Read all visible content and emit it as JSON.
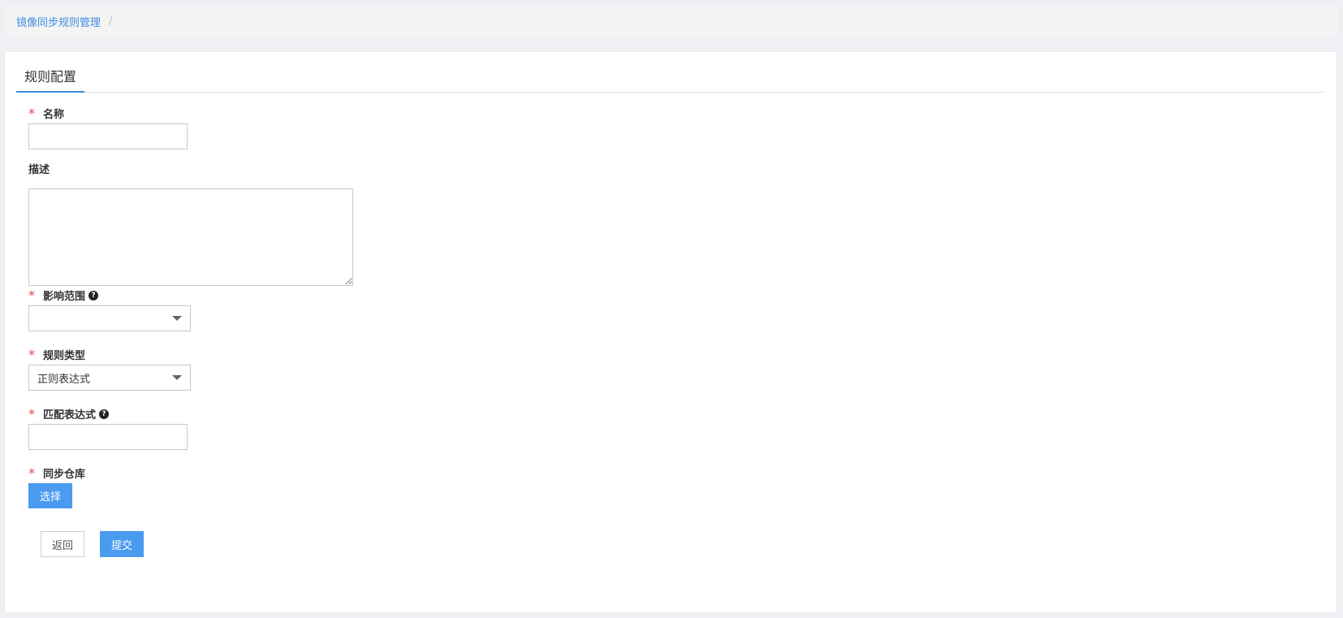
{
  "breadcrumb": {
    "items": [
      {
        "label": "镜像同步规则管理"
      }
    ],
    "separator": "/"
  },
  "tabs": [
    {
      "label": "规则配置",
      "active": true
    }
  ],
  "form": {
    "name": {
      "label": "名称",
      "required": "*",
      "value": ""
    },
    "description": {
      "label": "描述",
      "value": ""
    },
    "scope": {
      "label": "影响范围",
      "required": "*",
      "help": "?",
      "selected": ""
    },
    "rule_type": {
      "label": "规则类型",
      "required": "*",
      "selected": "正则表达式"
    },
    "match_expr": {
      "label": "匹配表达式",
      "required": "*",
      "help": "?",
      "value": ""
    },
    "sync_repo": {
      "label": "同步仓库",
      "required": "*",
      "button": "选择"
    }
  },
  "actions": {
    "back": "返回",
    "submit": "提交"
  },
  "colors": {
    "accent": "#4a9af0",
    "link": "#3c8dde",
    "required": "#e64340"
  }
}
